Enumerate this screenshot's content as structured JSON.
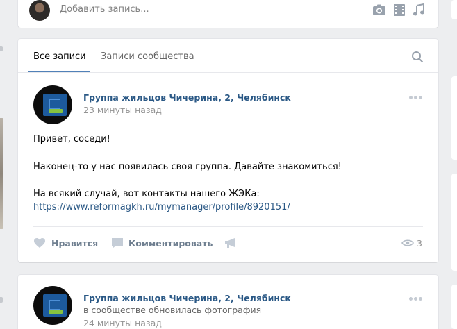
{
  "composer": {
    "placeholder": "Добавить запись..."
  },
  "feed": {
    "tabs": [
      {
        "label": "Все записи",
        "active": true
      },
      {
        "label": "Записи сообщества",
        "active": false
      }
    ],
    "posts": [
      {
        "author": "Группа жильцов Чичерина, 2, Челябинск",
        "time": "23 минуты назад",
        "lines": [
          "Привет, соседи!",
          "Наконец-то у нас появилась своя группа. Давайте знакомиться!",
          "На всякий случай, вот контакты нашего ЖЭКа:"
        ],
        "link": "https://www.reformagkh.ru/mymanager/profile/8920151/",
        "actions": {
          "like": "Нравится",
          "comment": "Комментировать"
        },
        "views": "3"
      },
      {
        "author": "Группа жильцов Чичерина, 2, Челябинск",
        "subtitle": "в сообществе обновилась фотография",
        "time": "24 минуты назад"
      }
    ]
  },
  "colors": {
    "accent": "#5181b8",
    "link": "#2a5885",
    "background": "#edeef0"
  }
}
